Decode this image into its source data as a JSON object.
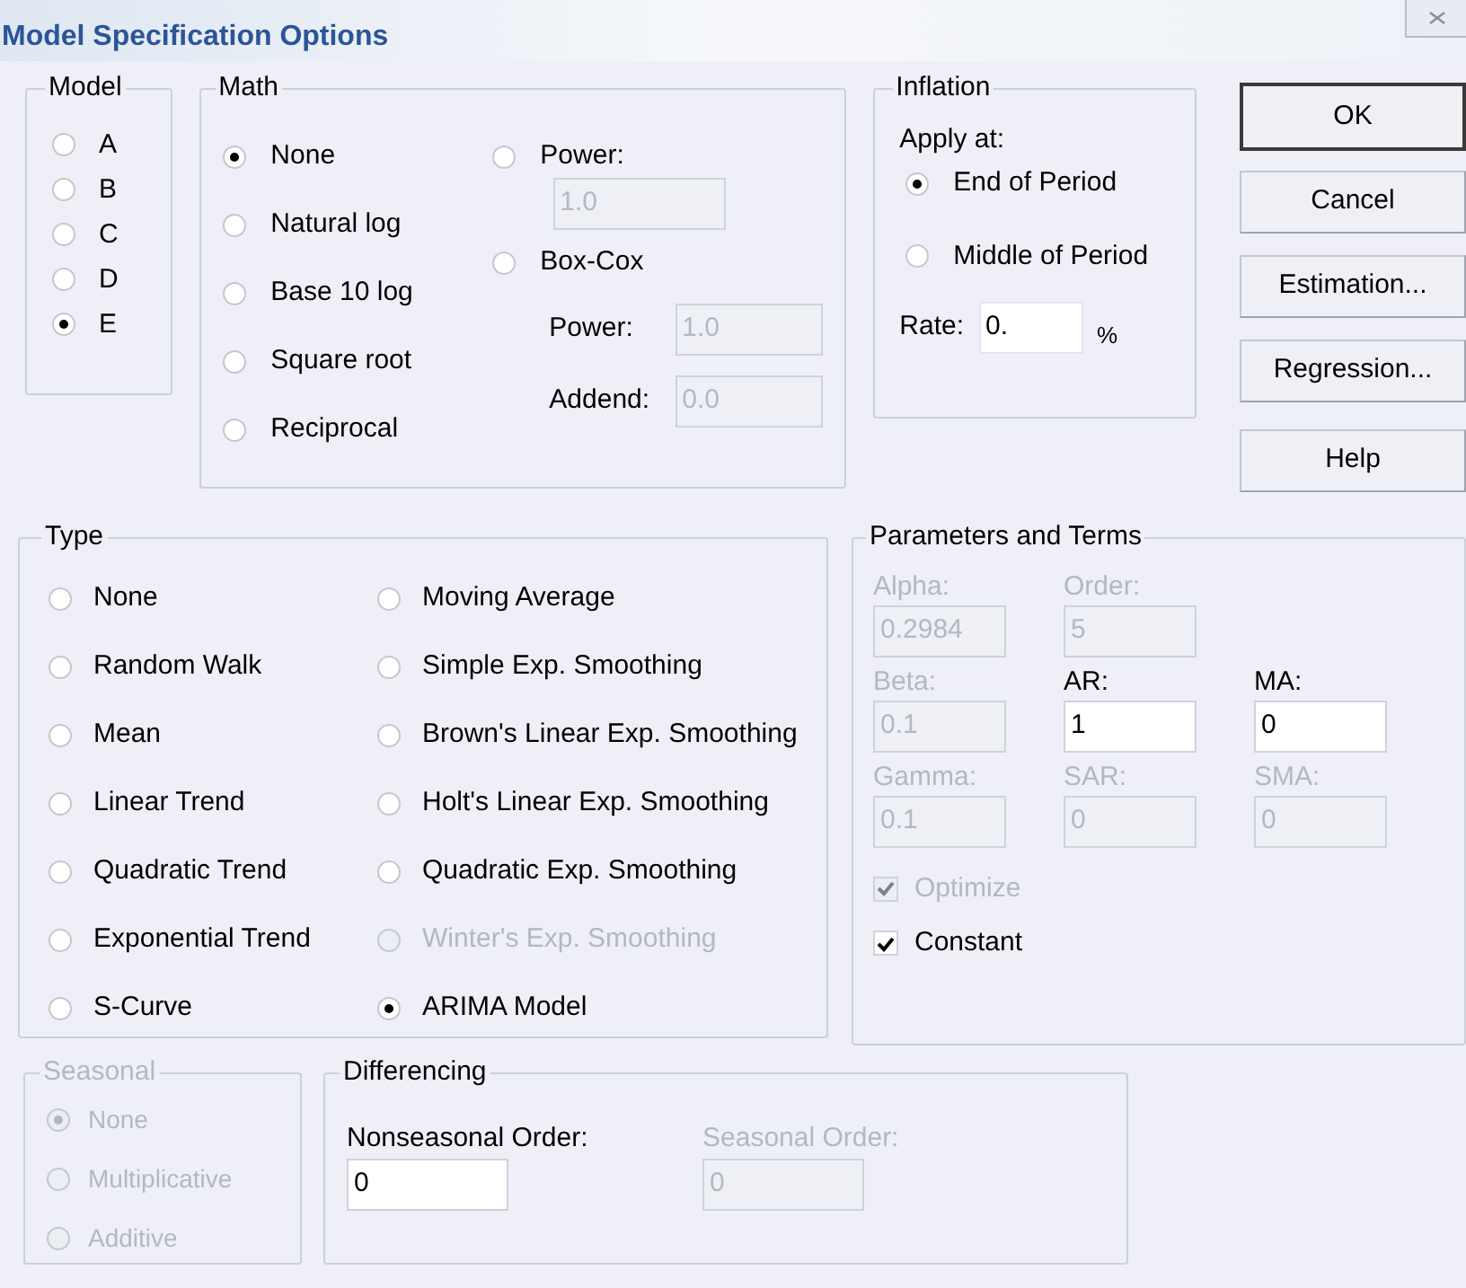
{
  "window": {
    "title": "Model Specification Options"
  },
  "model": {
    "label": "Model",
    "options": [
      {
        "label": "A",
        "selected": false
      },
      {
        "label": "B",
        "selected": false
      },
      {
        "label": "C",
        "selected": false
      },
      {
        "label": "D",
        "selected": false
      },
      {
        "label": "E",
        "selected": true
      }
    ]
  },
  "math": {
    "label": "Math",
    "options": [
      {
        "label": "None",
        "selected": true
      },
      {
        "label": "Natural log",
        "selected": false
      },
      {
        "label": "Base 10 log",
        "selected": false
      },
      {
        "label": "Square root",
        "selected": false
      },
      {
        "label": "Reciprocal",
        "selected": false
      }
    ],
    "power_option": {
      "label": "Power:",
      "selected": false
    },
    "power_field": {
      "value": "1.0",
      "disabled": true
    },
    "box_cox_option": {
      "label": "Box-Cox",
      "selected": false
    },
    "box_cox_fields": [
      {
        "label": "Power:",
        "value": "1.0",
        "disabled": true
      },
      {
        "label": "Addend:",
        "value": "0.0",
        "disabled": true
      }
    ]
  },
  "inflation": {
    "label": "Inflation",
    "apply_at": "Apply at:",
    "options": [
      {
        "label": "End of Period",
        "selected": true
      },
      {
        "label": "Middle of Period",
        "selected": false
      }
    ],
    "rate": {
      "label": "Rate:",
      "value": "0.",
      "unit": "%"
    }
  },
  "buttons": [
    {
      "label": "OK",
      "default": true
    },
    {
      "label": "Cancel",
      "default": false
    },
    {
      "label": "Estimation...",
      "default": false
    },
    {
      "label": "Regression...",
      "default": false
    },
    {
      "label": "Help",
      "default": false
    }
  ],
  "type": {
    "label": "Type",
    "columns": [
      {
        "options": [
          {
            "label": "None",
            "selected": false,
            "disabled": false
          },
          {
            "label": "Random Walk",
            "selected": false,
            "disabled": false
          },
          {
            "label": "Mean",
            "selected": false,
            "disabled": false
          },
          {
            "label": "Linear Trend",
            "selected": false,
            "disabled": false
          },
          {
            "label": "Quadratic Trend",
            "selected": false,
            "disabled": false
          },
          {
            "label": "Exponential Trend",
            "selected": false,
            "disabled": false
          },
          {
            "label": "S-Curve",
            "selected": false,
            "disabled": false
          }
        ]
      },
      {
        "options": [
          {
            "label": "Moving Average",
            "selected": false,
            "disabled": false
          },
          {
            "label": "Simple Exp. Smoothing",
            "selected": false,
            "disabled": false
          },
          {
            "label": "Brown's Linear Exp. Smoothing",
            "selected": false,
            "disabled": false
          },
          {
            "label": "Holt's Linear Exp. Smoothing",
            "selected": false,
            "disabled": false
          },
          {
            "label": "Quadratic Exp. Smoothing",
            "selected": false,
            "disabled": false
          },
          {
            "label": "Winter's Exp. Smoothing",
            "selected": false,
            "disabled": true
          },
          {
            "label": "ARIMA Model",
            "selected": true,
            "disabled": false
          }
        ]
      }
    ]
  },
  "parameters": {
    "label": "Parameters and Terms",
    "rows": [
      {
        "fields": [
          {
            "label": "Alpha:",
            "value": "0.2984",
            "disabled": true
          },
          {
            "label": "Order:",
            "value": "5",
            "disabled": true
          }
        ]
      },
      {
        "fields": [
          {
            "label": "Beta:",
            "value": "0.1",
            "disabled": true
          },
          {
            "label": "AR:",
            "value": "1",
            "disabled": false
          },
          {
            "label": "MA:",
            "value": "0",
            "disabled": false
          }
        ]
      },
      {
        "fields": [
          {
            "label": "Gamma:",
            "value": "0.1",
            "disabled": true
          },
          {
            "label": "SAR:",
            "value": "0",
            "disabled": true
          },
          {
            "label": "SMA:",
            "value": "0",
            "disabled": true
          }
        ]
      }
    ],
    "checkboxes": [
      {
        "label": "Optimize",
        "checked": true,
        "disabled": true
      },
      {
        "label": "Constant",
        "checked": true,
        "disabled": false
      }
    ]
  },
  "seasonal": {
    "label": "Seasonal",
    "disabled": true,
    "options": [
      {
        "label": "None",
        "selected": true
      },
      {
        "label": "Multiplicative",
        "selected": false
      },
      {
        "label": "Additive",
        "selected": false
      }
    ]
  },
  "differencing": {
    "label": "Differencing",
    "fields": [
      {
        "label": "Nonseasonal Order:",
        "value": "0",
        "disabled": false
      },
      {
        "label": "Seasonal Order:",
        "value": "0",
        "disabled": true
      }
    ]
  }
}
